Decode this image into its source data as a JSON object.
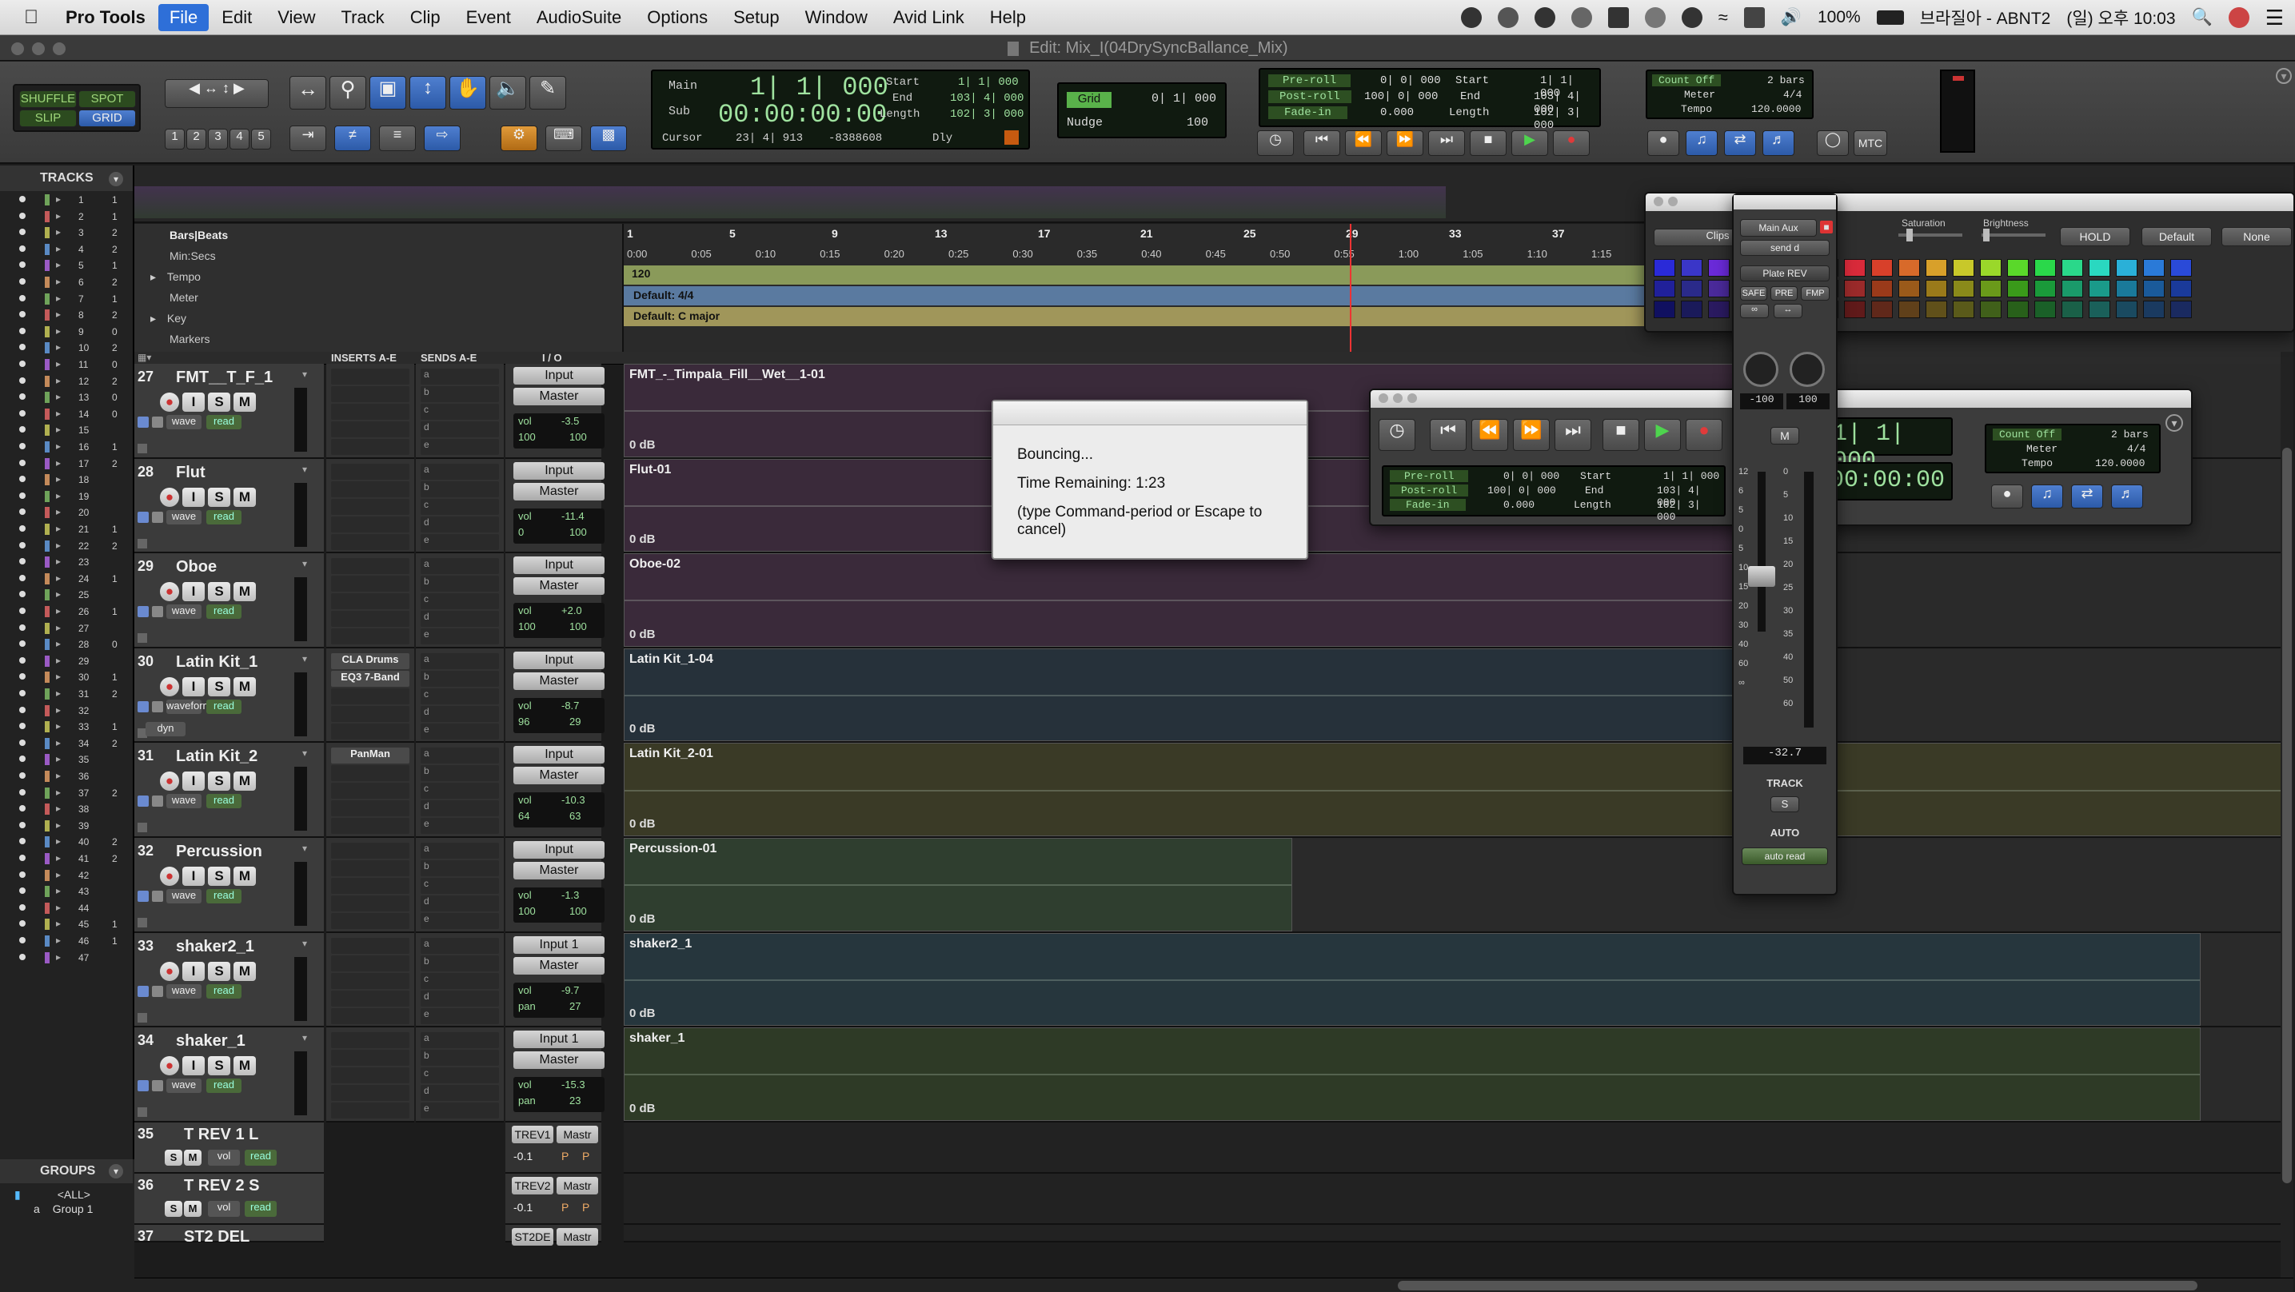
{
  "menubar": {
    "apple": "",
    "items": [
      "Pro Tools",
      "File",
      "Edit",
      "View",
      "Track",
      "Clip",
      "Event",
      "AudioSuite",
      "Options",
      "Setup",
      "Window",
      "Avid Link",
      "Help"
    ],
    "status": {
      "battery": "100%",
      "user": "브라질아 - ABNT2",
      "time": "(일) 오후 10:03"
    }
  },
  "window": {
    "title": "Edit: Mix_I(04DrySyncBallance_Mix)"
  },
  "edit_modes": {
    "shuffle": "SHUFFLE",
    "spot": "SPOT",
    "slip": "SLIP",
    "grid": "GRID"
  },
  "zoom_presets": [
    "1",
    "2",
    "3",
    "4",
    "5"
  ],
  "counters": {
    "main_label": "Main",
    "main_value": "1| 1| 000",
    "sub_label": "Sub",
    "sub_value": "00:00:00:00",
    "start_label": "Start",
    "start_value": "1| 1| 000",
    "end_label": "End",
    "end_value": "103| 4| 000",
    "length_label": "Length",
    "length_value": "102| 3| 000",
    "cursor_label": "Cursor",
    "cursor_value": "23| 4| 913",
    "cursor_extra": "-8388608",
    "dly": "Dly"
  },
  "grid_nudge": {
    "grid_label": "Grid",
    "grid_value": "0| 1| 000",
    "nudge_label": "Nudge",
    "nudge_value": "100"
  },
  "transport_lcd": {
    "preroll_label": "Pre-roll",
    "preroll_value": "0| 0| 000",
    "postroll_label": "Post-roll",
    "postroll_value": "100| 0| 000",
    "fadein_label": "Fade-in",
    "fadein_value": "0.000",
    "start_label": "Start",
    "start_value": "1| 1| 000",
    "end_label": "End",
    "end_value": "103| 4| 000",
    "length_label": "Length",
    "length_value": "102| 3| 000"
  },
  "count_meter": {
    "count_off": "Count Off",
    "bars": "2 bars",
    "meter_label": "Meter",
    "meter_value": "4/4",
    "tempo_label": "Tempo",
    "tempo_value": "120.0000",
    "mtc": "MTC"
  },
  "tracks_panel": {
    "header": "TRACKS",
    "rows": [
      "1",
      "2",
      "3",
      "4",
      "5",
      "6",
      "7",
      "8",
      "9",
      "10",
      "11",
      "12",
      "13",
      "14",
      "15",
      "16",
      "17",
      "18",
      "19",
      "20",
      "21",
      "22",
      "23",
      "24",
      "25",
      "26",
      "27",
      "28",
      "29",
      "30",
      "31",
      "32",
      "33",
      "34",
      "35",
      "36",
      "37",
      "38",
      "39",
      "40",
      "41",
      "42",
      "43",
      "44",
      "45",
      "46",
      "47"
    ],
    "col2": [
      "1",
      "1",
      "2",
      "2",
      "1",
      "2",
      "1",
      "2",
      "0",
      "2",
      "0",
      "2",
      "0",
      "0",
      "",
      "1",
      "2",
      "",
      "",
      "",
      "1",
      "2",
      "",
      "1",
      "",
      "1",
      "",
      "0",
      "",
      "1",
      "2",
      "",
      "1",
      "2",
      "",
      "",
      "2",
      "",
      "",
      "2",
      "2",
      "",
      "",
      "",
      "1",
      "1"
    ]
  },
  "groups_panel": {
    "header": "GROUPS",
    "all": "<ALL>",
    "group1": "Group 1",
    "group1_letter": "a"
  },
  "ruler": {
    "bars_label": "Bars|Beats",
    "minsecs_label": "Min:Secs",
    "tempo_label": "Tempo",
    "meter_label": "Meter",
    "key_label": "Key",
    "markers_label": "Markers",
    "bar_ticks": [
      "1",
      "5",
      "9",
      "13",
      "17",
      "21",
      "25",
      "29",
      "33",
      "37"
    ],
    "time_ticks": [
      "0:00",
      "0:05",
      "0:10",
      "0:15",
      "0:20",
      "0:25",
      "0:30",
      "0:35",
      "0:40",
      "0:45",
      "0:50",
      "0:55",
      "1:00",
      "1:05",
      "1:10",
      "1:15"
    ],
    "tempo_value": "120",
    "meter_value": "Default: 4/4",
    "key_value": "Default: C major"
  },
  "column_headers": {
    "inserts": "INSERTS A-E",
    "sends": "SENDS A-E",
    "io": "I / O"
  },
  "tracks": [
    {
      "num": "27",
      "name": "FMT__T_F_1",
      "clip": "FMT_-_Timpala_Fill__Wet__1-01",
      "vol": "-3.5",
      "pan_l": "100",
      "pan_r": "100",
      "io_in": "Input",
      "io_out": "Master",
      "view": "wave",
      "auto": "read",
      "db": "0 dB",
      "color": "#3a2a3a",
      "inserts": []
    },
    {
      "num": "28",
      "name": "Flut",
      "clip": "Flut-01",
      "vol": "-11.4",
      "pan_l": "0",
      "pan_r": "100",
      "io_in": "Input",
      "io_out": "Master",
      "view": "wave",
      "auto": "read",
      "db": "0 dB",
      "color": "#3a2a3a",
      "inserts": []
    },
    {
      "num": "29",
      "name": "Oboe",
      "clip": "Oboe-02",
      "vol": "+2.0",
      "pan_l": "100",
      "pan_r": "100",
      "io_in": "Input",
      "io_out": "Master",
      "view": "wave",
      "auto": "read",
      "db": "0 dB",
      "color": "#3a2a3a",
      "inserts": []
    },
    {
      "num": "30",
      "name": "Latin Kit_1",
      "clip": "Latin Kit_1-04",
      "vol": "-8.7",
      "pan_l": "96",
      "pan_r": "29",
      "io_in": "Input",
      "io_out": "Master",
      "view": "waveform",
      "auto": "read",
      "db": "0 dB",
      "color": "#26313a",
      "inserts": [
        "CLA Drums",
        "EQ3 7-Band"
      ],
      "extra": "dyn"
    },
    {
      "num": "31",
      "name": "Latin Kit_2",
      "clip": "Latin Kit_2-01",
      "vol": "-10.3",
      "pan_l": "64",
      "pan_r": "63",
      "io_in": "Input",
      "io_out": "Master",
      "view": "wave",
      "auto": "read",
      "db": "0 dB",
      "color": "#3a3a26",
      "inserts": [
        "PanMan"
      ]
    },
    {
      "num": "32",
      "name": "Percussion",
      "clip": "Percussion-01",
      "vol": "-1.3",
      "pan_l": "100",
      "pan_r": "100",
      "io_in": "Input",
      "io_out": "Master",
      "view": "wave",
      "auto": "read",
      "db": "0 dB",
      "color": "#2f3e2f",
      "inserts": []
    },
    {
      "num": "33",
      "name": "shaker2_1",
      "clip": "shaker2_1",
      "vol": "-9.7",
      "pan_l": "pan",
      "pan_r": "27",
      "io_in": "Input 1",
      "io_out": "Master",
      "view": "wave",
      "auto": "read",
      "db": "0 dB",
      "color": "#26363d",
      "inserts": []
    },
    {
      "num": "34",
      "name": "shaker_1",
      "clip": "shaker_1",
      "vol": "-15.3",
      "pan_l": "pan",
      "pan_r": "23",
      "io_in": "Input 1",
      "io_out": "Master",
      "view": "wave",
      "auto": "read",
      "db": "0 dB",
      "color": "#2e3a26",
      "inserts": []
    }
  ],
  "aux_tracks": [
    {
      "num": "35",
      "name": "T REV 1 L",
      "io_in": "TREV1",
      "io_out": "Mastr",
      "vol": "-0.1"
    },
    {
      "num": "36",
      "name": "T REV 2 S",
      "io_in": "TREV2",
      "io_out": "Mastr",
      "vol": "-0.1"
    },
    {
      "num": "37",
      "name": "ST2 DEL",
      "io_in": "ST2DE",
      "io_out": "Mastr"
    }
  ],
  "small_labels": {
    "I": "I",
    "S": "S",
    "M": "M",
    "vol": "vol",
    "read": "read",
    "pan": "pan",
    "P": "P",
    "sends": [
      "a",
      "b",
      "c",
      "d",
      "e"
    ]
  },
  "bounce_dialog": {
    "line1": "Bouncing...",
    "line2": "Time Remaining: 1:23",
    "line3": "(type Command-period or Escape to cancel)"
  },
  "floating_transport": {
    "counter": "1| 1| 000",
    "sub": "00:00:00",
    "count_off": "Count Off",
    "bars": "2 bars",
    "meter_label": "Meter",
    "meter_value": "4/4",
    "tempo_label": "Tempo",
    "tempo_value": "120.0000",
    "preroll_label": "Pre-roll",
    "preroll_value": "0| 0| 000",
    "postroll_label": "Post-roll",
    "postroll_value": "100| 0| 000",
    "fadein_label": "Fade-in",
    "fadein_value": "0.000",
    "start_label": "Start",
    "start_value": "1| 1| 000",
    "end_label": "End",
    "end_value": "103| 4| 000",
    "length_label": "Length",
    "length_value": "102| 3| 000"
  },
  "send_window": {
    "aux": "Main Aux",
    "send": "send d",
    "plugin": "Plate REV",
    "safe": "SAFE",
    "pre": "PRE",
    "fmp": "FMP",
    "pan_l": "-100",
    "pan_r": "100",
    "m": "M",
    "level": "-32.7",
    "track_label": "TRACK",
    "s": "S",
    "auto_label": "AUTO",
    "auto_value": "auto read",
    "scale": [
      "12",
      "6",
      "5",
      "0",
      "5",
      "10",
      "15",
      "20",
      "30",
      "40",
      "60",
      "∞"
    ],
    "scale_r": [
      "0",
      "5",
      "10",
      "15",
      "20",
      "25",
      "30",
      "35",
      "40",
      "50",
      "60"
    ]
  },
  "color_palette": {
    "clips": "Clips",
    "saturation": "Saturation",
    "brightness": "Brightness",
    "hold": "HOLD",
    "default": "Default",
    "none": "None"
  }
}
